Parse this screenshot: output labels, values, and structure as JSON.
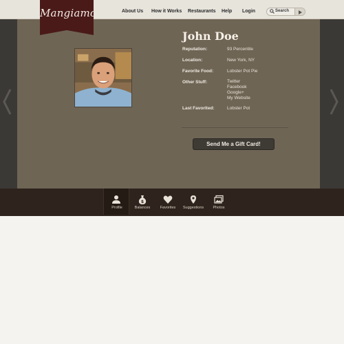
{
  "header": {
    "logo_text": "Mangiamo",
    "nav": [
      "About Us",
      "How it Works",
      "Restaurants",
      "Help",
      "Login"
    ],
    "search_label": "Search"
  },
  "profile": {
    "name": "John Doe",
    "fields": [
      {
        "label": "Reputation:",
        "value": "93 Percentile"
      },
      {
        "label": "Location:",
        "value": "New York, NY"
      },
      {
        "label": "Favorite Food:",
        "value": "Lobster Pot Pie"
      },
      {
        "label": "Other Stuff:",
        "links": [
          "Twitter",
          "Facebook",
          "Google+",
          "My Website"
        ]
      },
      {
        "label": "Last Favorited:",
        "value": "Lobster Pot"
      }
    ],
    "gift_button": "Send Me a Gift Card!"
  },
  "tabs": [
    {
      "label": "Profile",
      "icon": "person-icon",
      "active": true
    },
    {
      "label": "Balances",
      "icon": "money-bag-icon",
      "active": false
    },
    {
      "label": "Favorites",
      "icon": "heart-icon",
      "active": false
    },
    {
      "label": "Suggestions",
      "icon": "map-pin-icon",
      "active": false
    },
    {
      "label": "Photos",
      "icon": "photos-icon",
      "active": false
    }
  ],
  "colors": {
    "brand_maroon": "#4a1a18",
    "panel_brown": "#6f6555",
    "tabbar_dark": "#2f241d"
  }
}
